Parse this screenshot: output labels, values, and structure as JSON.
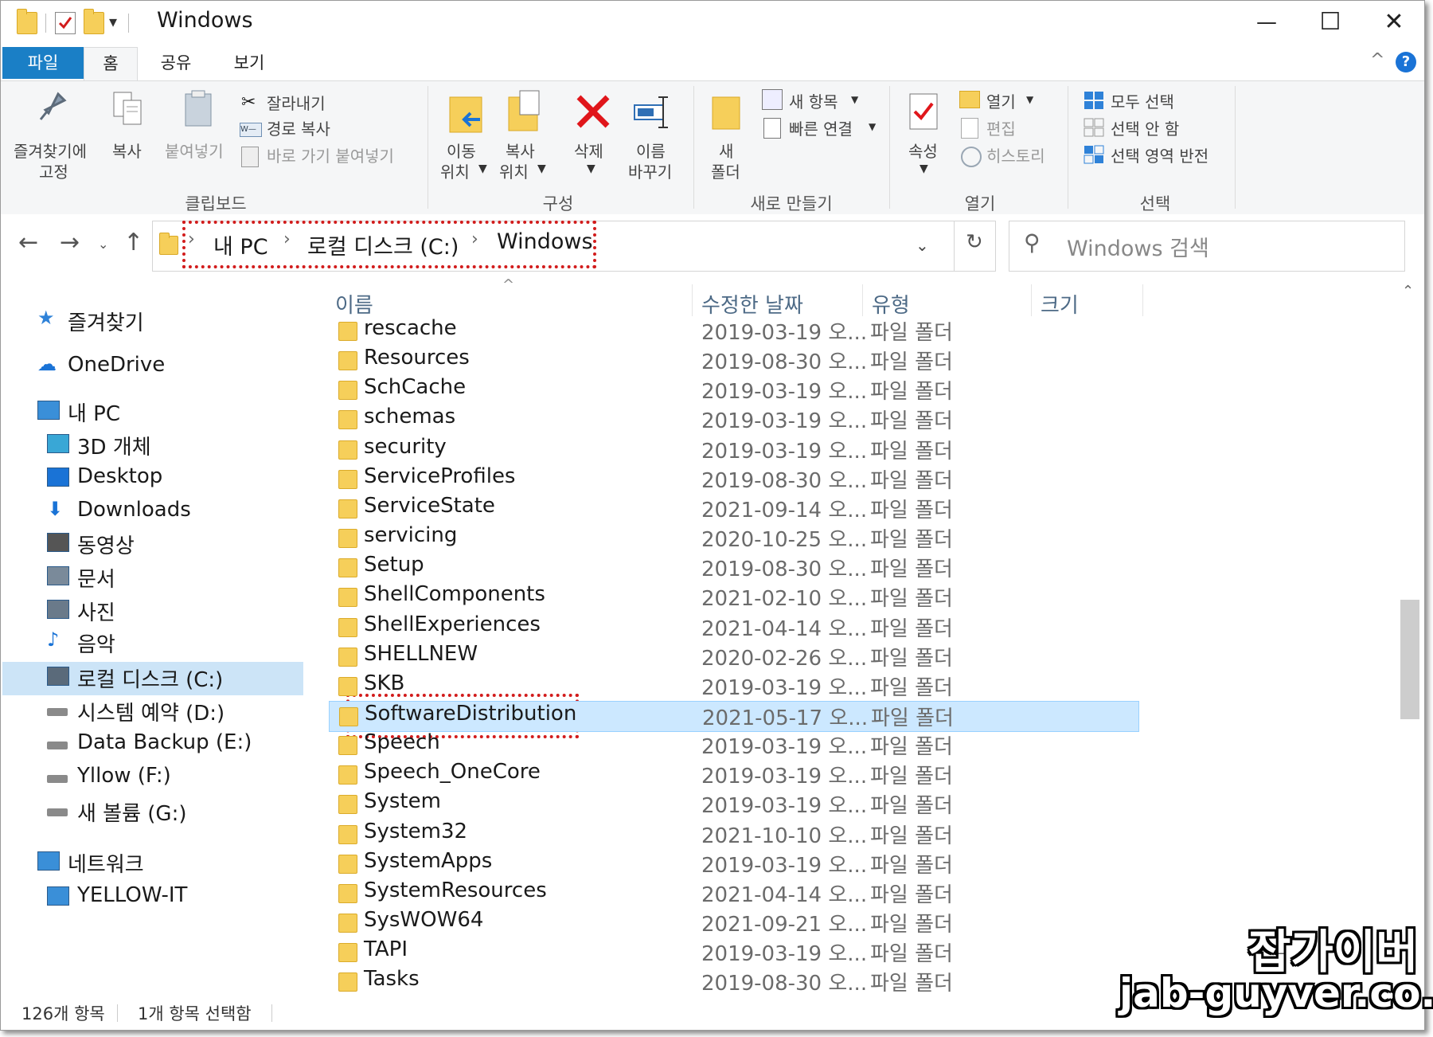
{
  "window": {
    "title": "Windows",
    "controls": {
      "minimize": "—",
      "maximize": "☐",
      "close": "✕"
    }
  },
  "ribbon_tabs": [
    "파일",
    "홈",
    "공유",
    "보기"
  ],
  "ribbon": {
    "clipboard": {
      "pin_line1": "즐겨찾기에",
      "pin_line2": "고정",
      "copy": "복사",
      "paste": "붙여넣기",
      "cut": "잘라내기",
      "copy_path": "경로 복사",
      "paste_shortcut": "바로 가기 붙여넣기",
      "group": "클립보드"
    },
    "organize": {
      "move_line1": "이동",
      "move_line2": "위치",
      "copyto_line1": "복사",
      "copyto_line2": "위치",
      "delete": "삭제",
      "rename_line1": "이름",
      "rename_line2": "바꾸기",
      "group": "구성"
    },
    "new": {
      "folder_line1": "새",
      "folder_line2": "폴더",
      "new_item": "새 항목",
      "easy_access": "빠른 연결",
      "group": "새로 만들기"
    },
    "open": {
      "properties": "속성",
      "open": "열기",
      "edit": "편집",
      "history": "히스토리",
      "group": "열기"
    },
    "select": {
      "select_all": "모두 선택",
      "select_none": "선택 안 함",
      "invert": "선택 영역 반전",
      "group": "선택"
    }
  },
  "address": {
    "crumbs": [
      "내 PC",
      "로컬 디스크 (C:)",
      "Windows"
    ],
    "search_placeholder": "Windows 검색"
  },
  "nav_pane": [
    {
      "label": "즐겨찾기",
      "icon": "star-icon"
    },
    {
      "label": "OneDrive",
      "icon": "cloud-icon"
    },
    {
      "label": "내 PC",
      "icon": "pc-icon"
    },
    {
      "label": "3D 개체",
      "icon": "cube-icon"
    },
    {
      "label": "Desktop",
      "icon": "desktop-icon"
    },
    {
      "label": "Downloads",
      "icon": "download-arrow-icon"
    },
    {
      "label": "동영상",
      "icon": "film-icon"
    },
    {
      "label": "문서",
      "icon": "document-icon"
    },
    {
      "label": "사진",
      "icon": "picture-icon"
    },
    {
      "label": "음악",
      "icon": "music-note-icon"
    },
    {
      "label": "로컬 디스크 (C:)",
      "icon": "windows-drive-icon",
      "selected": true
    },
    {
      "label": "시스템 예약 (D:)",
      "icon": "drive-icon"
    },
    {
      "label": "Data Backup (E:)",
      "icon": "drive-icon"
    },
    {
      "label": "Yllow (F:)",
      "icon": "drive-icon"
    },
    {
      "label": "새 볼륨 (G:)",
      "icon": "drive-icon"
    },
    {
      "label": "네트워크",
      "icon": "network-icon"
    },
    {
      "label": "YELLOW-IT",
      "icon": "computer-icon"
    }
  ],
  "columns": {
    "name": "이름",
    "date": "수정한 날짜",
    "type": "유형",
    "size": "크기"
  },
  "files": [
    {
      "name": "rescache",
      "date": "2019-03-19 오...",
      "type": "파일 폴더"
    },
    {
      "name": "Resources",
      "date": "2019-08-30 오...",
      "type": "파일 폴더"
    },
    {
      "name": "SchCache",
      "date": "2019-03-19 오...",
      "type": "파일 폴더"
    },
    {
      "name": "schemas",
      "date": "2019-03-19 오...",
      "type": "파일 폴더"
    },
    {
      "name": "security",
      "date": "2019-03-19 오...",
      "type": "파일 폴더"
    },
    {
      "name": "ServiceProfiles",
      "date": "2019-08-30 오...",
      "type": "파일 폴더"
    },
    {
      "name": "ServiceState",
      "date": "2021-09-14 오...",
      "type": "파일 폴더"
    },
    {
      "name": "servicing",
      "date": "2020-10-25 오...",
      "type": "파일 폴더"
    },
    {
      "name": "Setup",
      "date": "2019-08-30 오...",
      "type": "파일 폴더"
    },
    {
      "name": "ShellComponents",
      "date": "2021-02-10 오...",
      "type": "파일 폴더"
    },
    {
      "name": "ShellExperiences",
      "date": "2021-04-14 오...",
      "type": "파일 폴더"
    },
    {
      "name": "SHELLNEW",
      "date": "2020-02-26 오...",
      "type": "파일 폴더"
    },
    {
      "name": "SKB",
      "date": "2019-03-19 오...",
      "type": "파일 폴더"
    },
    {
      "name": "SoftwareDistribution",
      "date": "2021-05-17 오...",
      "type": "파일 폴더",
      "selected": true
    },
    {
      "name": "Speech",
      "date": "2019-03-19 오...",
      "type": "파일 폴더"
    },
    {
      "name": "Speech_OneCore",
      "date": "2019-03-19 오...",
      "type": "파일 폴더"
    },
    {
      "name": "System",
      "date": "2019-03-19 오...",
      "type": "파일 폴더"
    },
    {
      "name": "System32",
      "date": "2021-10-10 오...",
      "type": "파일 폴더"
    },
    {
      "name": "SystemApps",
      "date": "2019-03-19 오...",
      "type": "파일 폴더"
    },
    {
      "name": "SystemResources",
      "date": "2021-04-14 오...",
      "type": "파일 폴더"
    },
    {
      "name": "SysWOW64",
      "date": "2021-09-21 오...",
      "type": "파일 폴더"
    },
    {
      "name": "TAPI",
      "date": "2019-03-19 오...",
      "type": "파일 폴더"
    },
    {
      "name": "Tasks",
      "date": "2019-08-30 오...",
      "type": "파일 폴더"
    }
  ],
  "status": {
    "count": "126개 항목",
    "selected": "1개 항목 선택함"
  },
  "watermark": {
    "line1": "잡가이버",
    "line2": "jab-guyver.co.kr"
  },
  "colors": {
    "accent": "#1a7fc6",
    "selection": "#cce8ff",
    "highlight": "#d21c1c",
    "folder": "#f6cf5a"
  }
}
